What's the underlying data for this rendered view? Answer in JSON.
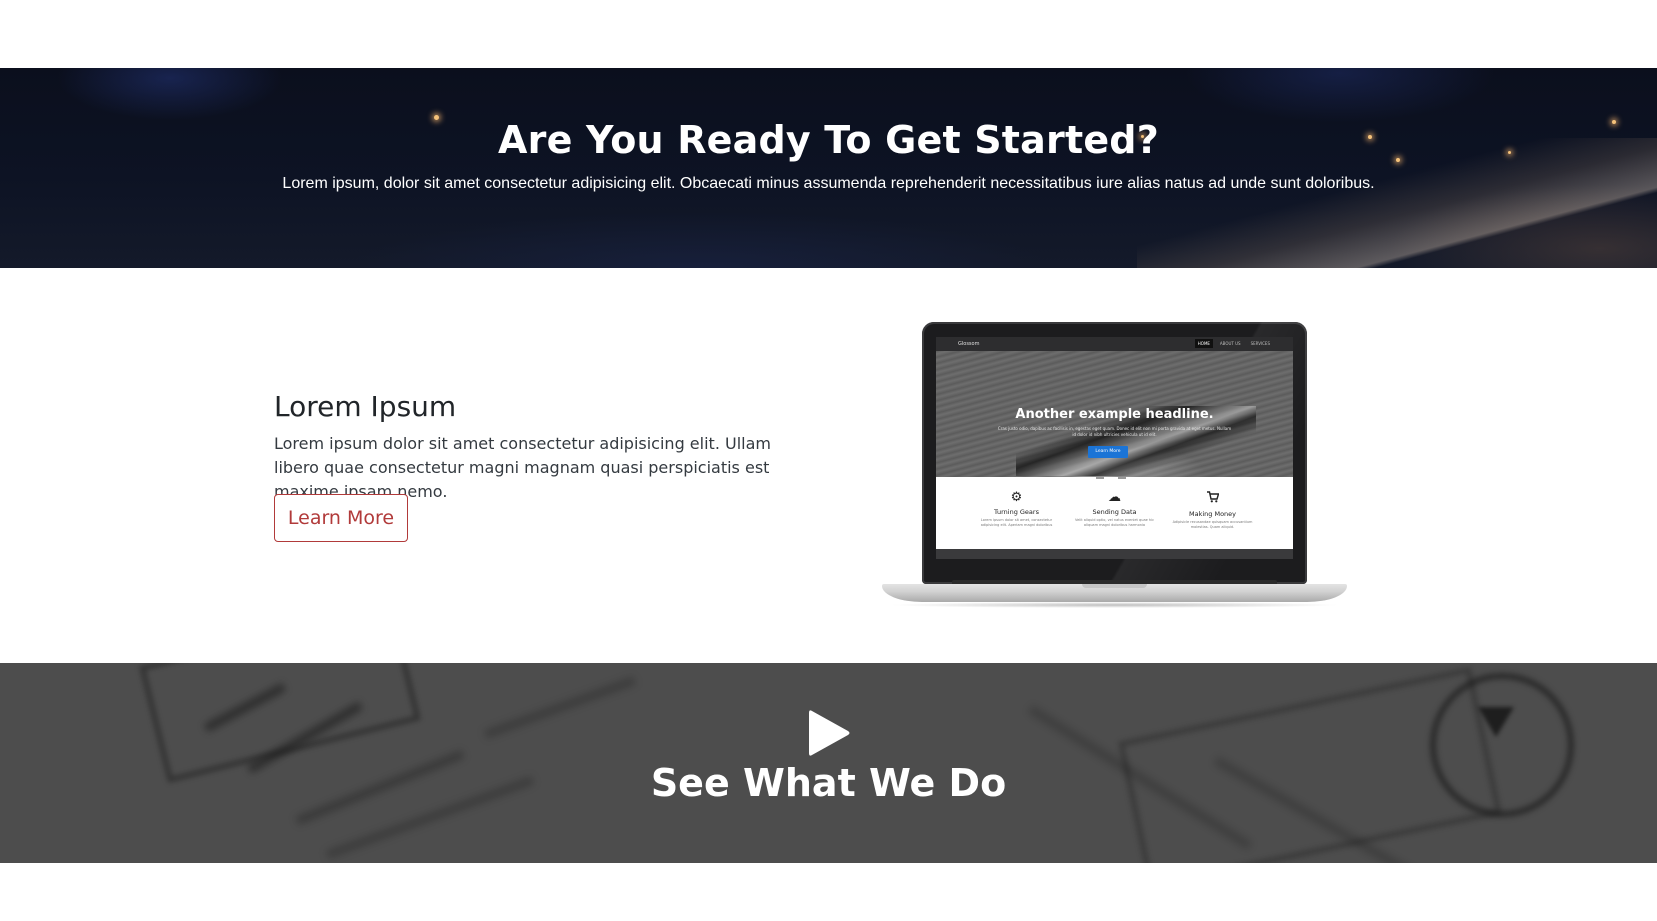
{
  "cta": {
    "title": "Are You Ready To Get Started?",
    "subtitle": "Lorem ipsum, dolor sit amet consectetur adipisicing elit. Obcaecati minus assumenda reprehenderit necessitatibus iure alias natus ad unde sunt doloribus."
  },
  "feature": {
    "title": "Lorem Ipsum",
    "text": "Lorem ipsum dolor sit amet consectetur adipisicing elit. Ullam libero quae consectetur magni magnam quasi perspiciatis est maxime ipsam nemo.",
    "button_label": "Learn More",
    "button_color": "#b13a3a"
  },
  "mockup": {
    "brand": "Glossom",
    "nav": [
      "HOME",
      "ABOUT US",
      "SERVICES"
    ],
    "headline": "Another example headline.",
    "subline": "Cras justo odio, dapibus ac facilisis in, egestas eget quam. Donec id elit non mi porta gravida at eget metus. Nullam id dolor id nibh ultricies vehicula ut id elit.",
    "button_label": "Learn More",
    "features": [
      {
        "icon": "gear-icon",
        "title": "Turning Gears",
        "text": "Lorem ipsum dolor sit amet, consectetur adipisicing elit. Aperiam magni doloribus"
      },
      {
        "icon": "cloud-icon",
        "title": "Sending Data",
        "text": "Velit aliquid optio, vel natus eveniet quae hic aliquam magni doloribus harmonia"
      },
      {
        "icon": "cart-icon",
        "title": "Making Money",
        "text": "Adipisicle recusandae quisquam accusantium molestias. Quam aliquid."
      }
    ]
  },
  "video": {
    "title": "See What We Do",
    "icon": "play-icon"
  }
}
